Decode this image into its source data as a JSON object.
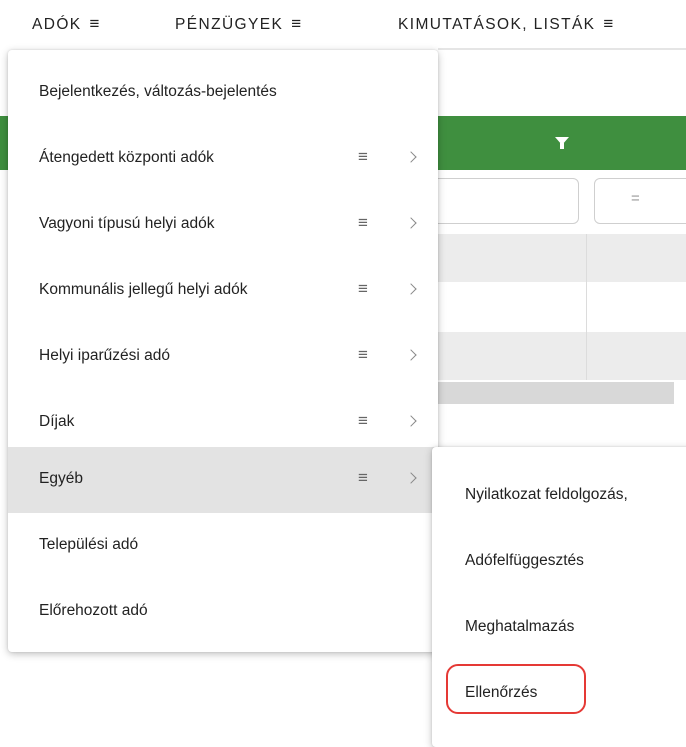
{
  "topnav": {
    "items": [
      {
        "label": "ADÓK",
        "icon": "≡"
      },
      {
        "label": "PÉNZÜGYEK",
        "icon": "≡"
      },
      {
        "label": "KIMUTATÁSOK, LISTÁK",
        "icon": "≡"
      }
    ]
  },
  "table": {
    "filter_operator": "="
  },
  "menu": {
    "items": [
      {
        "label": "Bejelentkezés, változás-bejelentés",
        "has_submenu": false
      },
      {
        "label": "Átengedett központi adók",
        "has_submenu": true,
        "icon": "≡"
      },
      {
        "label": "Vagyoni típusú helyi adók",
        "has_submenu": true,
        "icon": "≡"
      },
      {
        "label": "Kommunális jellegű helyi adók",
        "has_submenu": true,
        "icon": "≡"
      },
      {
        "label": "Helyi iparűzési adó",
        "has_submenu": true,
        "icon": "≡"
      },
      {
        "label": "Díjak",
        "has_submenu": true,
        "icon": "≡"
      },
      {
        "label": "Egyéb",
        "has_submenu": true,
        "icon": "≡",
        "active": true
      },
      {
        "label": "Települési adó",
        "has_submenu": false
      },
      {
        "label": "Előrehozott adó",
        "has_submenu": false
      }
    ]
  },
  "submenu": {
    "items": [
      {
        "label": "Nyilatkozat feldolgozás,"
      },
      {
        "label": "Adófelfüggesztés"
      },
      {
        "label": "Meghatalmazás"
      },
      {
        "label": "Ellenőrzés",
        "highlighted": true
      }
    ]
  },
  "colors": {
    "header_green": "#3f8f3f",
    "active_row": "#e3e3e3",
    "highlight_ring": "#e53935"
  }
}
